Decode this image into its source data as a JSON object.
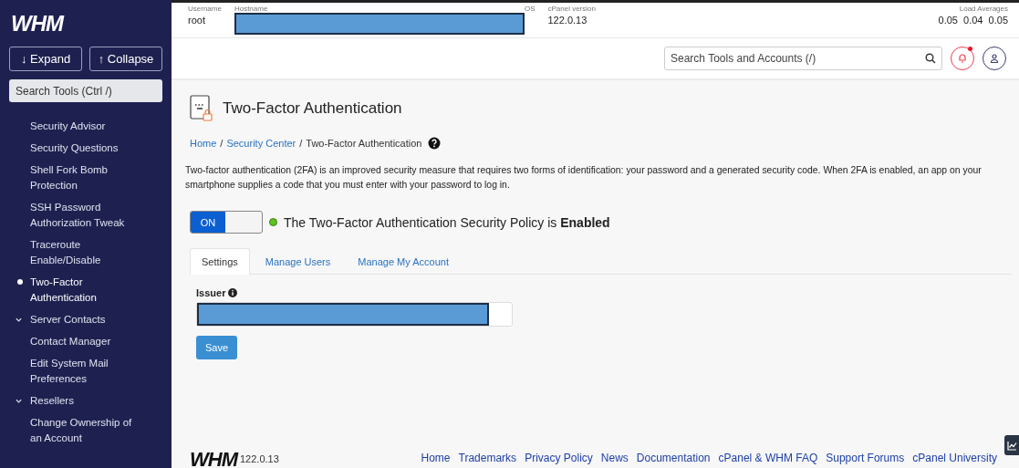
{
  "sidebar": {
    "logo": "WHM",
    "buttons": [
      {
        "label": "Expand",
        "arrow": "↓"
      },
      {
        "label": "Collapse",
        "arrow": "↑"
      }
    ],
    "search": {
      "placeholder": "Search Tools (Ctrl /)"
    },
    "items": [
      {
        "kind": "item",
        "label": "Security Advisor",
        "selected": false
      },
      {
        "kind": "item",
        "label": "Security Questions",
        "selected": false
      },
      {
        "kind": "item",
        "label": "Shell Fork Bomb Protection",
        "selected": false
      },
      {
        "kind": "item",
        "label": "SSH Password Authorization Tweak",
        "selected": false
      },
      {
        "kind": "item",
        "label": "Traceroute Enable/Disable",
        "selected": false
      },
      {
        "kind": "item",
        "label": "Two-Factor Authentication",
        "selected": true
      },
      {
        "kind": "section",
        "label": "Server Contacts",
        "expanded": true
      },
      {
        "kind": "item",
        "label": "Contact Manager",
        "selected": false
      },
      {
        "kind": "item",
        "label": "Edit System Mail Preferences",
        "selected": false
      },
      {
        "kind": "section",
        "label": "Resellers",
        "expanded": true
      },
      {
        "kind": "item",
        "label": "Change Ownership of an Account",
        "selected": false
      }
    ]
  },
  "server_info": [
    {
      "label": "Username",
      "value": "root"
    },
    {
      "label": "Hostname",
      "redacted": true
    },
    {
      "label": "OS"
    },
    {
      "label": "cPanel version",
      "value": "122.0.13"
    }
  ],
  "load_averages": {
    "label": "Load Averages",
    "value": "0.05  0.04  0.05"
  },
  "top_search": {
    "placeholder": "Search Tools and Accounts (/)"
  },
  "notifications": {
    "unread": true
  },
  "page": {
    "title": "Two-Factor Authentication",
    "breadcrumb": [
      {
        "label": "Home",
        "link": true,
        "separator": "/"
      },
      {
        "label": "Security Center",
        "link": true,
        "separator": "/"
      },
      {
        "label": "Two-Factor Authentication",
        "link": false
      }
    ],
    "description": "Two-factor authentication (2FA) is an improved security measure that requires two forms of identification: your password and a generated security code. When 2FA is enabled, an app on your smartphone supplies a code that you must enter with your password to log in.",
    "toggle": {
      "label": "ON",
      "on": true
    },
    "status": "The Two-Factor Authentication Security Policy is **Enabled**",
    "tabs": [
      {
        "label": "Settings",
        "selected": true
      },
      {
        "label": "Manage Users",
        "selected": false
      },
      {
        "label": "Manage My Account",
        "selected": false
      }
    ],
    "issuer": {
      "label": "Issuer",
      "redacted": true
    },
    "save": "Save"
  },
  "footer": {
    "logo": "WHM",
    "version": "122.0.13",
    "links": [
      "Home",
      "Trademarks",
      "Privacy Policy",
      "News",
      "Documentation",
      "cPanel & WHM FAQ",
      "Support Forums",
      "cPanel University"
    ]
  }
}
